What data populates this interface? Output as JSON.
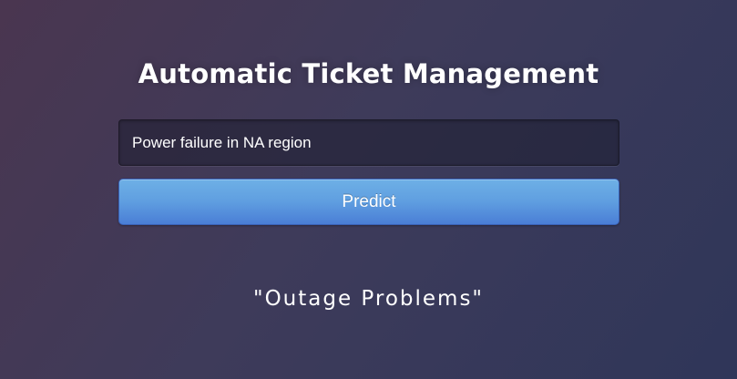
{
  "header": {
    "title": "Automatic Ticket Management"
  },
  "form": {
    "ticket_input_value": "Power failure in NA region",
    "predict_label": "Predict"
  },
  "result": {
    "text": "\"Outage Problems\""
  },
  "colors": {
    "background_start": "#4a3650",
    "background_end": "#2f3659",
    "button_top": "#6eb0e6",
    "button_bottom": "#4a7ed6",
    "text": "#ffffff"
  }
}
